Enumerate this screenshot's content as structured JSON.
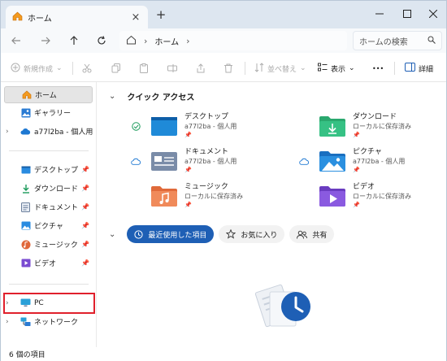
{
  "window": {
    "tab_title": "ホーム",
    "tab_close": "×",
    "new_tab": "+"
  },
  "address": {
    "crumb": "ホーム",
    "search_placeholder": "ホームの検索"
  },
  "commands": {
    "new": "新規作成",
    "sort": "並べ替え",
    "view": "表示",
    "more": "•••",
    "details": "詳細"
  },
  "sidebar": {
    "items": [
      {
        "label": "ホーム"
      },
      {
        "label": "ギャラリー"
      },
      {
        "label": "a77l2ba - 個人用"
      },
      {
        "label": "デスクトップ"
      },
      {
        "label": "ダウンロード"
      },
      {
        "label": "ドキュメント"
      },
      {
        "label": "ピクチャ"
      },
      {
        "label": "ミュージック"
      },
      {
        "label": "ビデオ"
      },
      {
        "label": "PC"
      },
      {
        "label": "ネットワーク"
      }
    ]
  },
  "quick_access": {
    "title": "クイック アクセス",
    "items": [
      {
        "name": "デスクトップ",
        "sub": "a77l2ba - 個人用"
      },
      {
        "name": "ダウンロード",
        "sub": "ローカルに保存済み"
      },
      {
        "name": "ドキュメント",
        "sub": "a77l2ba - 個人用"
      },
      {
        "name": "ピクチャ",
        "sub": "a77l2ba - 個人用"
      },
      {
        "name": "ミュージック",
        "sub": "ローカルに保存済み"
      },
      {
        "name": "ビデオ",
        "sub": "ローカルに保存済み"
      }
    ]
  },
  "filters": {
    "recent": "最近使用した項目",
    "favorites": "お気に入り",
    "shared": "共有"
  },
  "status": {
    "count": "6 個の項目"
  },
  "colors": {
    "accent": "#1e5fb5",
    "highlight_box": "#e0202c",
    "titlebar": "#dde6f0"
  }
}
